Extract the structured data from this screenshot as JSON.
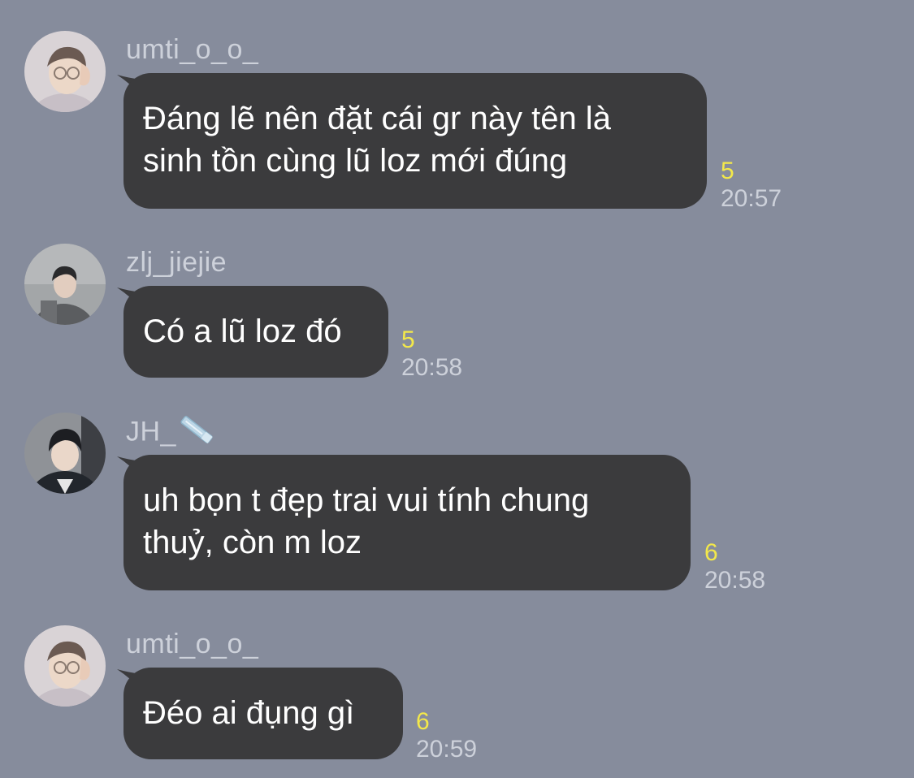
{
  "messages": [
    {
      "sender": "umti_o_o_",
      "text_lines": [
        "Đáng lẽ nên đặt cái gr này tên là",
        "sinh tồn cùng lũ loz mới đúng"
      ],
      "unread": "5",
      "time": "20:57",
      "avatar": "avatar-umti"
    },
    {
      "sender": "zlj_jiejie",
      "text_lines": [
        "Có a lũ loz đó"
      ],
      "unread": "5",
      "time": "20:58",
      "avatar": "avatar-zlj"
    },
    {
      "sender": "JH_",
      "sender_icon": "pencil-icon",
      "text_lines": [
        "uh bọn t đẹp trai vui tính chung",
        "thuỷ, còn m loz"
      ],
      "unread": "6",
      "time": "20:58",
      "avatar": "avatar-jh"
    },
    {
      "sender": "umti_o_o_",
      "text_lines": [
        "Đéo ai đụng gì"
      ],
      "unread": "6",
      "time": "20:59",
      "avatar": "avatar-umti"
    }
  ],
  "colors": {
    "background": "#868c9c",
    "bubble": "#3b3b3d",
    "unread": "#f3e84a",
    "meta_text": "#cdd1da"
  }
}
